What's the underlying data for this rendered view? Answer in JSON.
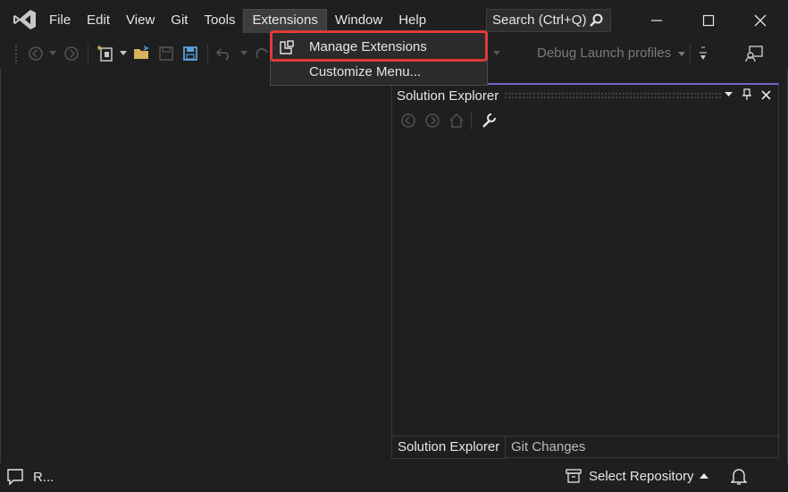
{
  "menu": {
    "items": [
      "File",
      "Edit",
      "View",
      "Git",
      "Tools",
      "Extensions",
      "Window",
      "Help"
    ],
    "search_placeholder": "Search (Ctrl+Q)"
  },
  "extensions_menu": {
    "items": [
      {
        "label": "Manage Extensions",
        "icon": "manage-extensions-icon"
      },
      {
        "label": "Customize Menu...",
        "icon": ""
      }
    ]
  },
  "toolbar": {
    "debug_profiles": "Debug Launch profiles"
  },
  "solution_explorer": {
    "title": "Solution Explorer",
    "tabs": [
      "Solution Explorer",
      "Git Changes"
    ]
  },
  "status": {
    "left_text": "R...",
    "repo": "Select Repository"
  },
  "colors": {
    "background": "#1f1f1f",
    "highlight_border": "#e03a3a",
    "panel_accent": "#7a62c6"
  }
}
